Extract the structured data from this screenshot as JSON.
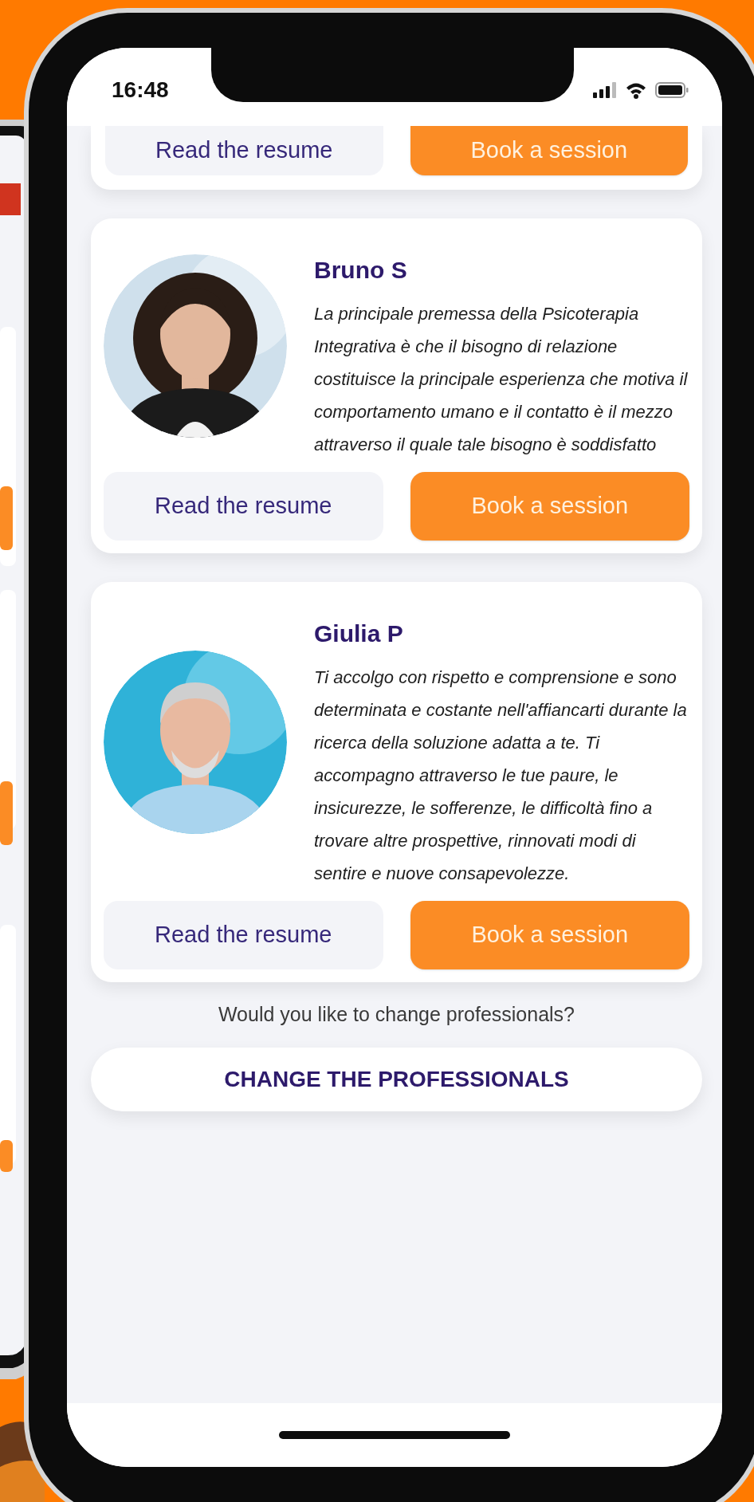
{
  "status_bar": {
    "time": "16:48"
  },
  "cards": [
    {
      "kind": "partial",
      "buttons": [
        {
          "kind": "secondary",
          "label": "Read the resume"
        },
        {
          "kind": "primary",
          "label": "Book a session"
        }
      ]
    },
    {
      "kind": "profile",
      "name": "Bruno S",
      "bio": "La principale premessa della Psicoterapia Integrativa è che il bisogno di relazione costituisce la principale esperienza che motiva il comportamento umano e il contatto è il mezzo attraverso il quale tale bisogno è soddisfatto",
      "buttons": [
        {
          "kind": "secondary",
          "label": "Read the resume"
        },
        {
          "kind": "primary",
          "label": "Book a session"
        }
      ]
    },
    {
      "kind": "profile",
      "name": "Giulia P",
      "bio": "Ti accolgo con rispetto e comprensione e sono determinata e costante nell'affiancarti durante la ricerca della soluzione adatta a te. Ti accompagno attraverso le tue paure, le insicurezze, le sofferenze, le difficoltà fino a trovare altre prospettive, rinnovati modi di sentire e nuove consapevolezze.",
      "buttons": [
        {
          "kind": "secondary",
          "label": "Read the resume"
        },
        {
          "kind": "primary",
          "label": "Book a session"
        }
      ]
    }
  ],
  "prompt": "Would you like to change professionals?",
  "change_button": "CHANGE THE PROFESSIONALS"
}
